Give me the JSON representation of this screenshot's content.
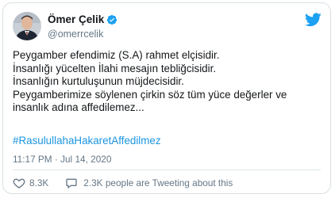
{
  "tweet": {
    "author_name": "Ömer Çelik",
    "handle": "@omerrcelik",
    "lines": [
      "Peygamber efendimiz (S.A) rahmet elçisidir.",
      "İnsanlığı yücelten İlahi mesajın tebliğcisidir.",
      "İnsanlığın kurtuluşunun müjdecisidir.",
      "Peygamberimize söylenen çirkin söz tüm yüce değerler ve",
      "insanlık adına affedilemez..."
    ],
    "hashtag": "#RasulullahaHakaretAffedilmez",
    "timestamp": "11:17 PM · Jul 14, 2020",
    "likes": "8.3K",
    "retweet_text": "2.3K people are Tweeting about this"
  },
  "icons": {
    "platform": "twitter-bird",
    "verified": "verified-badge",
    "like": "heart",
    "reply": "speech-bubble"
  },
  "colors": {
    "accent": "#1da1f2",
    "link": "#1b95e0",
    "secondary_text": "#657786",
    "border": "#d8dfe4"
  }
}
